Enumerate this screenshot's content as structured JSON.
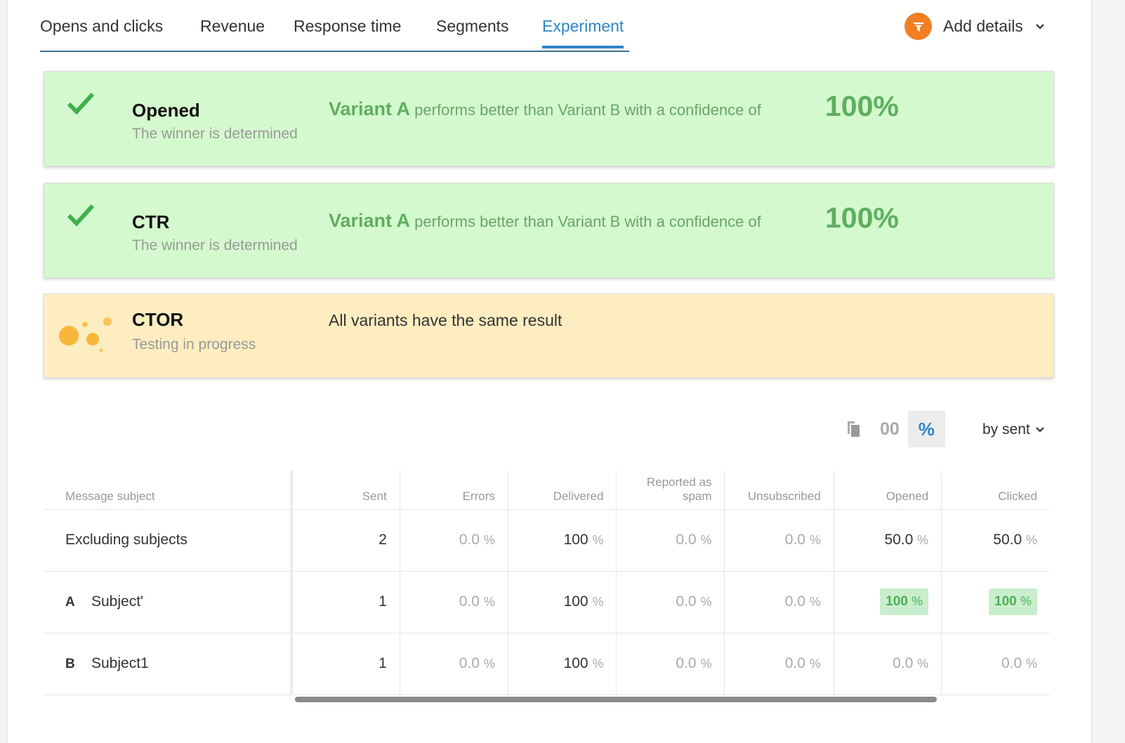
{
  "tabs": [
    "Opens and clicks",
    "Revenue",
    "Response time",
    "Segments",
    "Experiment"
  ],
  "active_tab": "Experiment",
  "add_details": "Add details",
  "cards": [
    {
      "name": "Opened",
      "status": "The winner is determined",
      "variant": "Variant A",
      "message": "performs better than Variant B with a confidence of",
      "confidence": "100%"
    },
    {
      "name": "CTR",
      "status": "The winner is determined",
      "variant": "Variant A",
      "message": "performs better than Variant B with a confidence of",
      "confidence": "100%"
    },
    {
      "name": "CTOR",
      "status": "Testing in progress",
      "message": "All variants have the same result"
    }
  ],
  "toolbar": {
    "absolute_label": "00",
    "percent_label": "%",
    "sort": "by sent"
  },
  "table": {
    "headers": [
      "Message subject",
      "Sent",
      "Errors",
      "Delivered",
      "Reported as spam",
      "Unsubscribed",
      "Opened",
      "Clicked"
    ],
    "rows": [
      {
        "letter": "",
        "subject": "Excluding subjects",
        "sent": "2",
        "errors": "0.0",
        "delivered": "100",
        "spam": "0.0",
        "unsub": "0.0",
        "opened": "50.0",
        "clicked": "50.0"
      },
      {
        "letter": "A",
        "subject": "Subject'",
        "sent": "1",
        "errors": "0.0",
        "delivered": "100",
        "spam": "0.0",
        "unsub": "0.0",
        "opened": "100",
        "clicked": "100"
      },
      {
        "letter": "B",
        "subject": "Subject1",
        "sent": "1",
        "errors": "0.0",
        "delivered": "100",
        "spam": "0.0",
        "unsub": "0.0",
        "opened": "0.0",
        "clicked": "0.0"
      }
    ],
    "unit": "%"
  }
}
